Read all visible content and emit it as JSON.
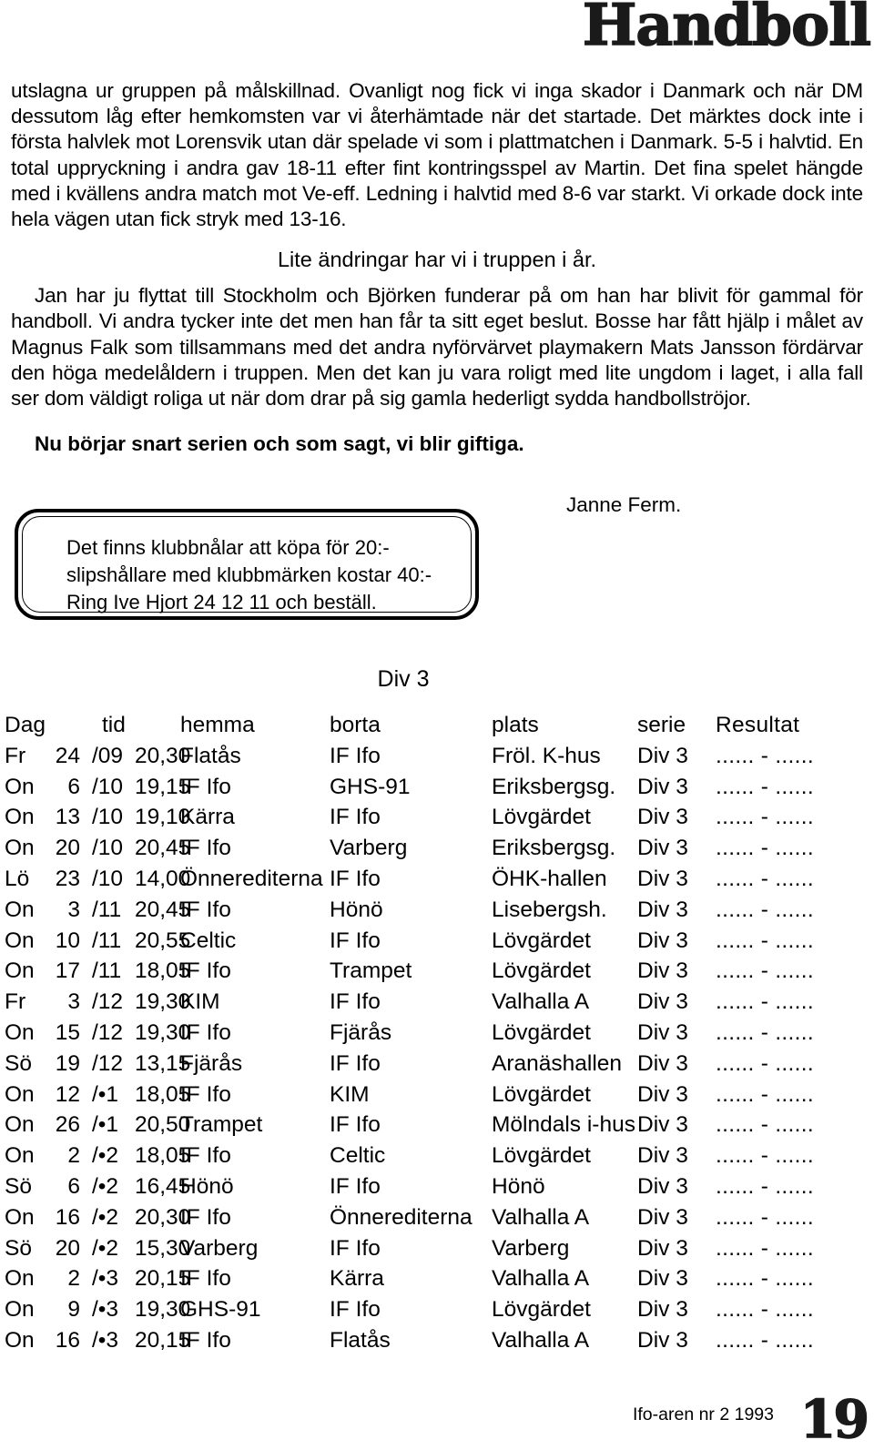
{
  "masthead": {
    "title": "Handboll"
  },
  "article": {
    "paragraph_1": "utslagna ur gruppen på målskillnad. Ovanligt nog fick vi inga skador i Danmark och när DM dessutom låg efter hemkomsten var vi återhämtade när det startade. Det märktes dock inte i första halvlek mot Lorensvik utan där spelade vi som i plattmatchen i Danmark. 5-5 i halvtid. En total uppryckning i andra gav 18-11 efter fint kontringsspel av Martin. Det fina spelet hängde med i kvällens andra match mot Ve-eff. Ledning i halvtid med 8-6 var starkt. Vi orkade dock inte hela vägen utan fick stryk med 13-16.",
    "subheading": "Lite ändringar har vi i truppen i år.",
    "paragraph_2": "Jan har ju flyttat till Stockholm och Björken funderar på om han har blivit för gammal för handboll. Vi andra tycker inte det men han får ta sitt eget beslut. Bosse har fått hjälp i målet av Magnus Falk som tillsammans med det andra nyförvärvet playmakern Mats Jansson fördärvar den höga medelåldern i truppen. Men det kan ju vara roligt med lite ungdom i laget, i alla fall ser dom väldigt roliga ut när dom drar på sig gamla hederligt sydda handbollströjor.",
    "closing_bold": "Nu börjar snart serien och som sagt, vi blir giftiga.",
    "signature": "Janne Ferm."
  },
  "notice": {
    "text": "Det finns klubbnålar att köpa för 20:-\nslipshållare med klubbmärken kostar 40:-\nRing Ive Hjort 24 12 11 och beställ."
  },
  "schedule": {
    "title": "Div 3",
    "headers": {
      "dag": "Dag",
      "tid": "tid",
      "hemma": "hemma",
      "borta": "borta",
      "plats": "plats",
      "serie": "serie",
      "resultat": "Resultat"
    },
    "result_blank": "...... - ......",
    "rows": [
      {
        "dag": "Fr",
        "day": "24",
        "month": "/09",
        "tid": "20,30",
        "hemma": "Flatås",
        "borta": "IF Ifo",
        "plats": "Fröl. K-hus",
        "serie": "Div 3",
        "resultat": "...... - ......"
      },
      {
        "dag": "On",
        "day": "6",
        "month": "/10",
        "tid": "19,15",
        "hemma": "IF Ifo",
        "borta": "GHS-91",
        "plats": "Eriksbergsg.",
        "serie": "Div 3",
        "resultat": "...... - ......"
      },
      {
        "dag": "On",
        "day": "13",
        "month": "/10",
        "tid": "19,10",
        "hemma": "Kärra",
        "borta": "IF Ifo",
        "plats": "Lövgärdet",
        "serie": "Div 3",
        "resultat": "...... - ......"
      },
      {
        "dag": "On",
        "day": "20",
        "month": "/10",
        "tid": "20,45",
        "hemma": "IF Ifo",
        "borta": "Varberg",
        "plats": "Eriksbergsg.",
        "serie": "Div 3",
        "resultat": "...... - ......"
      },
      {
        "dag": "Lö",
        "day": "23",
        "month": "/10",
        "tid": "14,00",
        "hemma": "Önnerediterna",
        "borta": "IF Ifo",
        "plats": "ÖHK-hallen",
        "serie": "Div 3",
        "resultat": "...... - ......"
      },
      {
        "dag": "On",
        "day": "3",
        "month": "/11",
        "tid": "20,45",
        "hemma": "IF Ifo",
        "borta": "Hönö",
        "plats": "Lisebergsh.",
        "serie": "Div 3",
        "resultat": "...... - ......"
      },
      {
        "dag": "On",
        "day": "10",
        "month": "/11",
        "tid": "20,55",
        "hemma": "Celtic",
        "borta": "IF Ifo",
        "plats": "Lövgärdet",
        "serie": "Div 3",
        "resultat": "...... - ......"
      },
      {
        "dag": "On",
        "day": "17",
        "month": "/11",
        "tid": "18,05",
        "hemma": "IF Ifo",
        "borta": "Trampet",
        "plats": "Lövgärdet",
        "serie": "Div 3",
        "resultat": "...... - ......"
      },
      {
        "dag": "Fr",
        "day": "3",
        "month": "/12",
        "tid": "19,30",
        "hemma": "KIM",
        "borta": "IF Ifo",
        "plats": "Valhalla A",
        "serie": "Div 3",
        "resultat": "...... - ......"
      },
      {
        "dag": "On",
        "day": "15",
        "month": "/12",
        "tid": "19,30",
        "hemma": "IF Ifo",
        "borta": "Fjärås",
        "plats": "Lövgärdet",
        "serie": "Div 3",
        "resultat": "...... - ......"
      },
      {
        "dag": "Sö",
        "day": "19",
        "month": "/12",
        "tid": "13,15",
        "hemma": "Fjärås",
        "borta": "IF Ifo",
        "plats": "Aranäshallen",
        "serie": "Div 3",
        "resultat": "...... - ......"
      },
      {
        "dag": "On",
        "day": "12",
        "month": "/•1",
        "tid": "18,05",
        "hemma": "IF Ifo",
        "borta": "KIM",
        "plats": "Lövgärdet",
        "serie": "Div 3",
        "resultat": "...... - ......"
      },
      {
        "dag": "On",
        "day": "26",
        "month": "/•1",
        "tid": "20,50",
        "hemma": "Trampet",
        "borta": "IF Ifo",
        "plats": "Mölndals i-hus",
        "serie": "Div 3",
        "resultat": "...... - ......"
      },
      {
        "dag": "On",
        "day": "2",
        "month": "/•2",
        "tid": "18,05",
        "hemma": "IF Ifo",
        "borta": "Celtic",
        "plats": "Lövgärdet",
        "serie": "Div 3",
        "resultat": "...... - ......"
      },
      {
        "dag": "Sö",
        "day": "6",
        "month": "/•2",
        "tid": "16,45",
        "hemma": "Hönö",
        "borta": "IF Ifo",
        "plats": "Hönö",
        "serie": "Div 3",
        "resultat": "...... - ......"
      },
      {
        "dag": "On",
        "day": "16",
        "month": "/•2",
        "tid": "20,30",
        "hemma": "IF Ifo",
        "borta": "Önnerediterna",
        "plats": "Valhalla A",
        "serie": "Div 3",
        "resultat": "...... - ......"
      },
      {
        "dag": "Sö",
        "day": "20",
        "month": "/•2",
        "tid": "15,30",
        "hemma": "Varberg",
        "borta": "IF Ifo",
        "plats": "Varberg",
        "serie": "Div 3",
        "resultat": "...... - ......"
      },
      {
        "dag": "On",
        "day": "2",
        "month": "/•3",
        "tid": "20,15",
        "hemma": "IF Ifo",
        "borta": "Kärra",
        "plats": "Valhalla A",
        "serie": "Div 3",
        "resultat": "...... - ......"
      },
      {
        "dag": "On",
        "day": "9",
        "month": "/•3",
        "tid": "19,30",
        "hemma": "GHS-91",
        "borta": "IF Ifo",
        "plats": "Lövgärdet",
        "serie": "Div 3",
        "resultat": "...... - ......"
      },
      {
        "dag": "On",
        "day": "16",
        "month": "/•3",
        "tid": "20,15",
        "hemma": "IF Ifo",
        "borta": "Flatås",
        "plats": "Valhalla A",
        "serie": "Div 3",
        "resultat": "...... - ......"
      }
    ]
  },
  "footer": {
    "publication": "Ifo-aren nr 2 1993",
    "page_number": "19"
  }
}
